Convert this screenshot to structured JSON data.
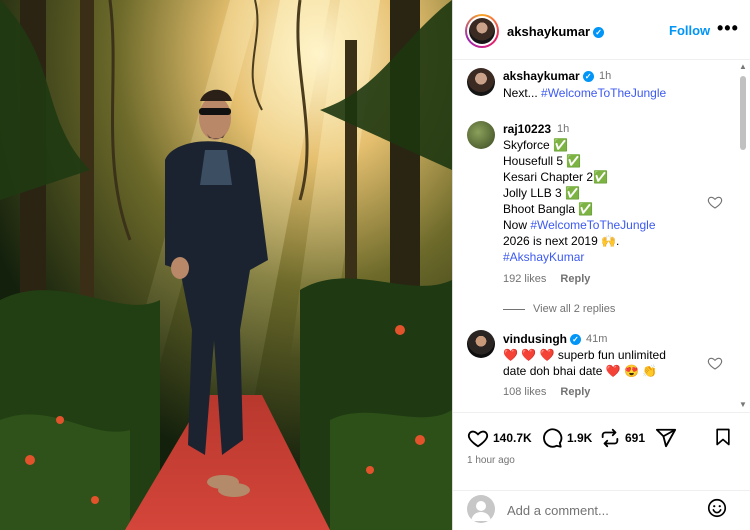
{
  "post": {
    "author": "akshaykumar",
    "follow_label": "Follow",
    "more_label": "•••"
  },
  "caption": {
    "author": "akshaykumar",
    "time": "1h",
    "text_prefix": "Next... ",
    "hashtag": "#WelcomeToTheJungle"
  },
  "comments": [
    {
      "author": "raj10223",
      "time": "1h",
      "lines": [
        "Skyforce ✅",
        "Housefull 5 ✅",
        "Kesari Chapter 2✅",
        "Jolly LLB 3  ✅",
        "Bhoot Bangla ✅"
      ],
      "line_now_prefix": "Now ",
      "line_now_tag": "#WelcomeToTheJungle",
      "line_year": "2026 is next 2019 🙌.",
      "line_tag": "#AkshayKumar",
      "likes": "192 likes",
      "reply": "Reply",
      "view_replies": "View all 2 replies"
    },
    {
      "author": "vindusingh",
      "time": "41m",
      "line1": "❤️ ❤️ ❤️  superb fun unlimited",
      "line2": "date doh bhai date ❤️ 😍 👏",
      "likes": "108 likes",
      "reply": "Reply"
    }
  ],
  "actions": {
    "likes_count": "140.7K",
    "comments_count": "1.9K",
    "reposts_count": "691",
    "posted_ago": "1 hour ago"
  },
  "add_comment": {
    "placeholder": "Add a comment..."
  },
  "colors": {
    "accent_blue": "#0095f6",
    "hashtag_blue": "#3d5af1",
    "muted_gray": "#737373"
  }
}
